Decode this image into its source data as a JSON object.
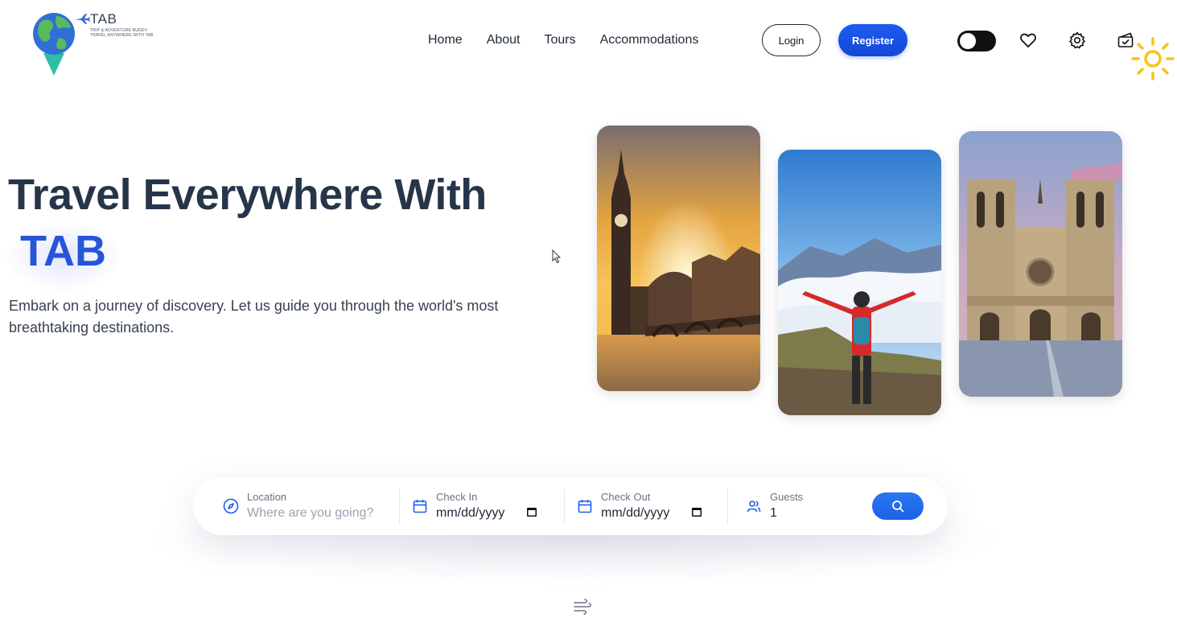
{
  "brand": {
    "name": "TAB",
    "tagline_line1": "TRIP & ADVENTURE BUDDY",
    "tagline_line2": "TRAVEL ANYWHERE WITH TAB"
  },
  "nav": {
    "items": [
      "Home",
      "About",
      "Tours",
      "Accommodations"
    ]
  },
  "auth": {
    "login_label": "Login",
    "register_label": "Register"
  },
  "header_icons": [
    "theme-toggle",
    "heart-icon",
    "gear-icon",
    "ticket-icon",
    "sun-icon"
  ],
  "hero": {
    "title": "Travel Everywhere With",
    "brand_word": "TAB",
    "subtitle": "Embark on a journey of discovery. Let us guide you through the world's most breathtaking destinations."
  },
  "search": {
    "location": {
      "label": "Location",
      "placeholder": "Where are you going?"
    },
    "check_in": {
      "label": "Check In",
      "value": "mm/dd/yyyy"
    },
    "check_out": {
      "label": "Check Out",
      "value": "mm/dd/yyyy"
    },
    "guests": {
      "label": "Guests",
      "value": "1"
    }
  },
  "colors": {
    "primary": "#1d5cf0",
    "heading": "#27354a",
    "brand_accent": "#2556d8",
    "sun": "#f5c518"
  }
}
